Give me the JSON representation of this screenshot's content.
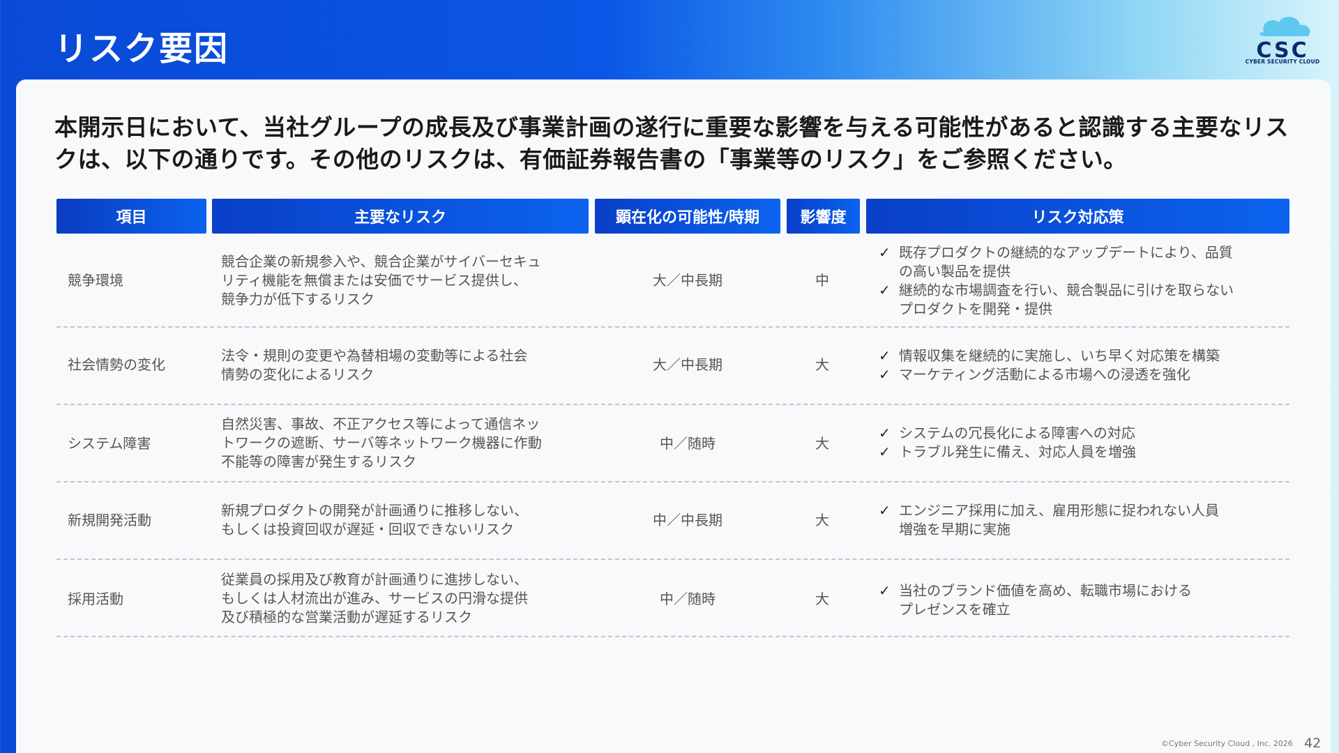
{
  "header": {
    "title": "リスク要因",
    "logo_text": "CSC",
    "logo_subtext": "CYBER SECURITY CLOUD"
  },
  "lead_text": "本開示日において、当社グループの成長及び事業計画の遂行に重要な影響を与える可能性があると認識する主要なリスクは、以下の通りです。その他のリスクは、有価証券報告書の「事業等のリスク」をご参照ください。",
  "table": {
    "headers": [
      "項目",
      "主要なリスク",
      "顕在化の可能性/時期",
      "影響度",
      "リスク対応策"
    ],
    "rows": [
      {
        "item": "競争環境",
        "risk": [
          "競合企業の新規参入や、競合企業がサイバーセキュ",
          "リティ機能を無償または安価でサービス提供し、",
          "競争力が低下するリスク"
        ],
        "possibility": "大／中長期",
        "impact": "中",
        "responses": [
          [
            "既存プロダクトの継続的なアップデートにより、品質",
            "の高い製品を提供"
          ],
          [
            "継続的な市場調査を行い、競合製品に引けを取らない",
            "プロダクトを開発・提供"
          ]
        ]
      },
      {
        "item": "社会情勢の変化",
        "risk": [
          "法令・規則の変更や為替相場の変動等による社会",
          "情勢の変化によるリスク"
        ],
        "possibility": "大／中長期",
        "impact": "大",
        "responses": [
          [
            "情報収集を継続的に実施し、いち早く対応策を構築"
          ],
          [
            "マーケティング活動による市場への浸透を強化"
          ]
        ]
      },
      {
        "item": "システム障害",
        "risk": [
          "自然災害、事故、不正アクセス等によって通信ネッ",
          "トワークの遮断、サーバ等ネットワーク機器に作動",
          "不能等の障害が発生するリスク"
        ],
        "possibility": "中／随時",
        "impact": "大",
        "responses": [
          [
            "システムの冗長化による障害への対応"
          ],
          [
            "トラブル発生に備え、対応人員を増強"
          ]
        ]
      },
      {
        "item": "新規開発活動",
        "risk": [
          "新規プロダクトの開発が計画通りに推移しない、",
          "もしくは投資回収が遅延・回収できないリスク"
        ],
        "possibility": "中／中長期",
        "impact": "大",
        "responses": [
          [
            "エンジニア採用に加え、雇用形態に捉われない人員",
            "増強を早期に実施"
          ]
        ]
      },
      {
        "item": "採用活動",
        "risk": [
          "従業員の採用及び教育が計画通りに進捗しない、",
          "もしくは人材流出が進み、サービスの円滑な提供",
          "及び積極的な営業活動が遅延するリスク"
        ],
        "possibility": "中／随時",
        "impact": "大",
        "responses": [
          [
            "当社のブランド価値を高め、転職市場における",
            "プレゼンスを確立"
          ]
        ]
      }
    ]
  },
  "footer": {
    "copyright": "©Cyber Security Cloud , Inc. 2026",
    "page_number": "42"
  },
  "colors": {
    "header_blue": "#0b56e6",
    "text": "#555555"
  }
}
